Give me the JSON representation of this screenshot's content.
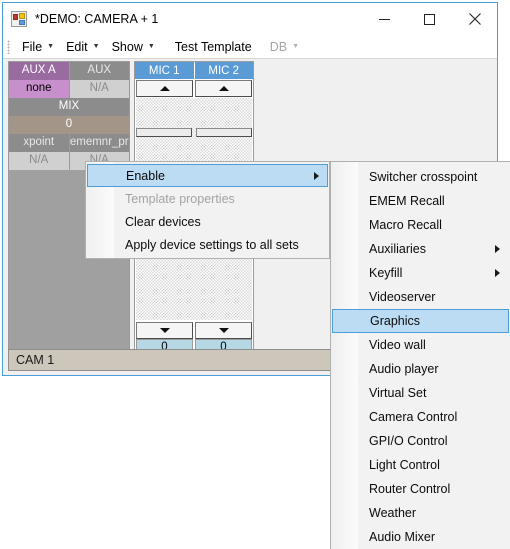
{
  "window": {
    "title": "*DEMO: CAMERA + 1",
    "icon": "app-grid-icon",
    "minimize_label": "—",
    "maximize_label": "□",
    "close_label": "×",
    "border_color": "#4a9fd8"
  },
  "menubar": {
    "items": [
      {
        "label": "File",
        "has_caret": true,
        "disabled": false
      },
      {
        "label": "Edit",
        "has_caret": true,
        "disabled": false
      },
      {
        "label": "Show",
        "has_caret": true,
        "disabled": false
      },
      {
        "label": "Test Template",
        "has_caret": false,
        "disabled": false
      },
      {
        "label": "DB",
        "has_caret": true,
        "disabled": true
      }
    ]
  },
  "device_panel": {
    "rows": [
      {
        "cells": [
          {
            "text": "AUX A",
            "style": "header-aux"
          },
          {
            "text": "AUX",
            "style": "header-gray"
          }
        ]
      },
      {
        "cells": [
          {
            "text": "none",
            "style": "value-aux"
          },
          {
            "text": "N/A",
            "style": "value-gray"
          }
        ]
      },
      {
        "cells": [
          {
            "text": "MIX",
            "style": "header-gray-wide"
          }
        ]
      },
      {
        "cells": [
          {
            "text": "0",
            "style": "value-mix-wide"
          }
        ]
      },
      {
        "cells": [
          {
            "text": "xpoint",
            "style": "header-gray"
          },
          {
            "text": "ememnr_pr",
            "style": "header-gray"
          }
        ]
      },
      {
        "cells": [
          {
            "text": "N/A",
            "style": "value-gray"
          },
          {
            "text": "N/A",
            "style": "value-gray"
          }
        ]
      }
    ],
    "colors": {
      "aux_header": "#9a6ba0",
      "aux_value": "#c78fcb",
      "gray_header": "#8c8c8c",
      "gray_value": "#d0d0d0",
      "mix_value": "#a39688",
      "panel_bg": "#a0a0a0"
    }
  },
  "mic_panel": {
    "columns": [
      {
        "header": "MIC 1",
        "up_icon": "triangle-up-icon",
        "down_icon": "triangle-down-icon",
        "value": "0"
      },
      {
        "header": "MIC 2",
        "up_icon": "triangle-up-icon",
        "down_icon": "triangle-down-icon",
        "value": "0"
      }
    ],
    "header_color": "#5b9bd5",
    "value_color": "#b5d8e4"
  },
  "status_bar": {
    "text": "CAM 1",
    "background": "#cdc6ba"
  },
  "context_menu": {
    "items": [
      {
        "label": "Enable",
        "has_submenu": true,
        "disabled": false,
        "selected": true
      },
      {
        "label": "Template properties",
        "has_submenu": false,
        "disabled": true,
        "selected": false
      },
      {
        "label": "Clear devices",
        "has_submenu": false,
        "disabled": false,
        "selected": false
      },
      {
        "label": "Apply device settings to all sets",
        "has_submenu": false,
        "disabled": false,
        "selected": false
      }
    ]
  },
  "submenu": {
    "items": [
      {
        "label": "Switcher crosspoint",
        "has_submenu": false,
        "selected": false
      },
      {
        "label": "EMEM Recall",
        "has_submenu": false,
        "selected": false
      },
      {
        "label": "Macro Recall",
        "has_submenu": false,
        "selected": false
      },
      {
        "label": "Auxiliaries",
        "has_submenu": true,
        "selected": false
      },
      {
        "label": "Keyfill",
        "has_submenu": true,
        "selected": false
      },
      {
        "label": "Videoserver",
        "has_submenu": false,
        "selected": false
      },
      {
        "label": "Graphics",
        "has_submenu": false,
        "selected": true
      },
      {
        "label": "Video wall",
        "has_submenu": false,
        "selected": false
      },
      {
        "label": "Audio player",
        "has_submenu": false,
        "selected": false
      },
      {
        "label": "Virtual Set",
        "has_submenu": false,
        "selected": false
      },
      {
        "label": "Camera Control",
        "has_submenu": false,
        "selected": false
      },
      {
        "label": "GPI/O Control",
        "has_submenu": false,
        "selected": false
      },
      {
        "label": "Light Control",
        "has_submenu": false,
        "selected": false
      },
      {
        "label": "Router Control",
        "has_submenu": false,
        "selected": false
      },
      {
        "label": "Weather",
        "has_submenu": false,
        "selected": false
      },
      {
        "label": "Audio Mixer",
        "has_submenu": false,
        "selected": false
      }
    ],
    "highlight_color": "#bcdcf4",
    "highlight_border": "#4a9fd8"
  }
}
